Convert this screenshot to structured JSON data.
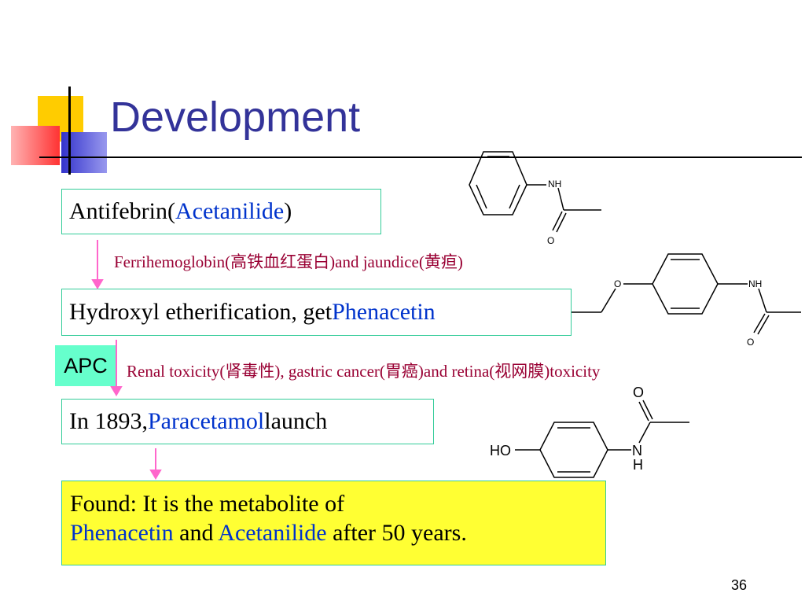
{
  "slide": {
    "title": "Development",
    "page_number": "36"
  },
  "steps": {
    "step1": {
      "text": "Antifebrin(",
      "highlight": "Acetanilide",
      "suffix": ")"
    },
    "note1": {
      "pre": "Ferrihemoglobin(高铁血红蛋白)",
      "mid": "and jaundice(黄疸)"
    },
    "step2": {
      "text": "Hydroxyl etherification, get ",
      "highlight": "Phenacetin"
    },
    "apc_label": "APC",
    "note2": {
      "part1": "Renal toxicity(肾毒性)",
      "part2": ", gastric cancer(胃癌)",
      "part3": "and retina(视网膜)",
      "part4": "toxicity"
    },
    "step3": {
      "text": "In 1893, ",
      "highlight": "Paracetamol",
      "suffix": " launch"
    },
    "found": {
      "line1": "Found: It is the metabolite of",
      "hl1": "Phenacetin",
      "and": " and ",
      "hl2": "Acetanilide",
      "tail": " after 50 years."
    }
  },
  "structures": {
    "acetanilide": {
      "nh": "NH",
      "o": "O"
    },
    "phenacetin": {
      "o_ether": "O",
      "nh": "NH",
      "o": "O"
    },
    "paracetamol": {
      "ho": "HO",
      "n": "N",
      "h": "H",
      "o": "O"
    }
  },
  "colors": {
    "title": "#333399",
    "highlight": "#0033cc",
    "note": "#990033",
    "box_border": "#33cc99",
    "arrow": "#ff66cc",
    "apc_bg": "#66ffcc",
    "found_bg": "#ffff33"
  }
}
